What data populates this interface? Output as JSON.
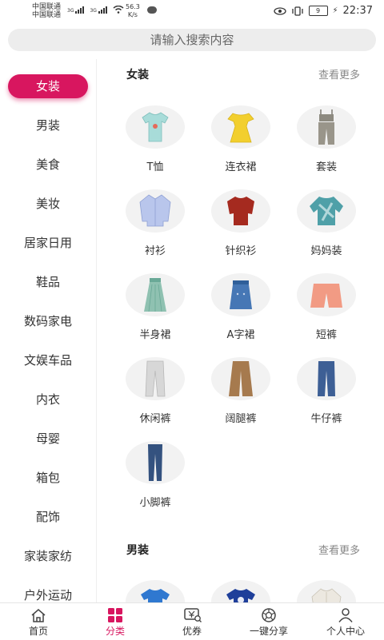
{
  "status": {
    "carrier1": "中国联通",
    "carrier2": "中国联通",
    "net1": "3G",
    "net2": "3G",
    "speed_value": "56.3",
    "speed_unit": "K/s",
    "battery": "9",
    "time": "22:37"
  },
  "search": {
    "placeholder": "请输入搜索内容"
  },
  "sidebar": {
    "categories": [
      "女装",
      "男装",
      "美食",
      "美妆",
      "居家日用",
      "鞋品",
      "数码家电",
      "文娱车品",
      "内衣",
      "母婴",
      "箱包",
      "配饰",
      "家装家纺",
      "户外运动"
    ],
    "active_index": 0
  },
  "sections": [
    {
      "title": "女装",
      "more": "查看更多",
      "items": [
        {
          "label": "T恤",
          "icon": "tshirt-icon"
        },
        {
          "label": "连衣裙",
          "icon": "dress-icon"
        },
        {
          "label": "套装",
          "icon": "suit-icon"
        },
        {
          "label": "衬衫",
          "icon": "shirt-icon"
        },
        {
          "label": "针织衫",
          "icon": "knit-sweater-icon"
        },
        {
          "label": "妈妈装",
          "icon": "mom-top-icon"
        },
        {
          "label": "半身裙",
          "icon": "skirt-icon"
        },
        {
          "label": "A字裙",
          "icon": "denim-skirt-icon"
        },
        {
          "label": "短裤",
          "icon": "shorts-icon"
        },
        {
          "label": "休闲裤",
          "icon": "casual-pants-icon"
        },
        {
          "label": "阔腿裤",
          "icon": "wide-pants-icon"
        },
        {
          "label": "牛仔裤",
          "icon": "jeans-icon"
        },
        {
          "label": "小脚裤",
          "icon": "skinny-pants-icon"
        }
      ]
    },
    {
      "title": "男装",
      "more": "查看更多",
      "items": [
        {
          "label": "",
          "icon": "blue-tshirt-icon"
        },
        {
          "label": "",
          "icon": "navy-tshirt-icon"
        },
        {
          "label": "",
          "icon": "jacket-icon"
        }
      ]
    }
  ],
  "tabbar": {
    "tabs": [
      {
        "label": "首页",
        "icon": "home-icon"
      },
      {
        "label": "分类",
        "icon": "category-icon"
      },
      {
        "label": "优券",
        "icon": "coupon-icon"
      },
      {
        "label": "一键分享",
        "icon": "share-icon"
      },
      {
        "label": "个人中心",
        "icon": "user-icon"
      }
    ],
    "active_index": 1
  },
  "colors": {
    "accent": "#d8165f",
    "search_bg": "#ededed",
    "item_bg": "#f2f2f2"
  }
}
